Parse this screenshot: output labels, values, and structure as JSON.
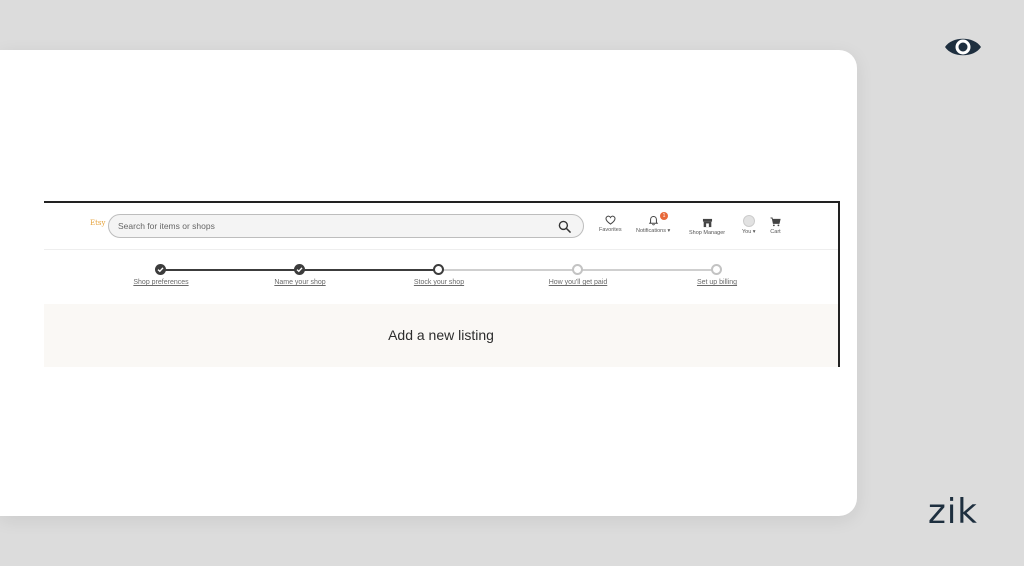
{
  "brand": {
    "name": "zik"
  },
  "etsy_header": {
    "logo_text": "Etsy",
    "search_placeholder": "Search for items or shops",
    "nav": {
      "favorites": "Favorites",
      "notifications": "Notifications",
      "notifications_badge": "1",
      "shop_manager": "Shop Manager",
      "you": "You",
      "cart": "Cart"
    }
  },
  "stepper": {
    "steps": [
      {
        "label": "Shop preferences",
        "status": "complete"
      },
      {
        "label": "Name your shop",
        "status": "complete"
      },
      {
        "label": "Stock your shop",
        "status": "current"
      },
      {
        "label": "How you'll get paid",
        "status": "pending"
      },
      {
        "label": "Set up billing",
        "status": "pending"
      }
    ]
  },
  "banner": {
    "title": "Add a new listing"
  },
  "colors": {
    "background": "#dcdcdc",
    "brand_text": "#1e2f3f",
    "step_complete": "#3c3c3c",
    "step_pending": "#c3c3c3",
    "badge": "#e8693a",
    "banner_bg": "#faf8f5"
  }
}
